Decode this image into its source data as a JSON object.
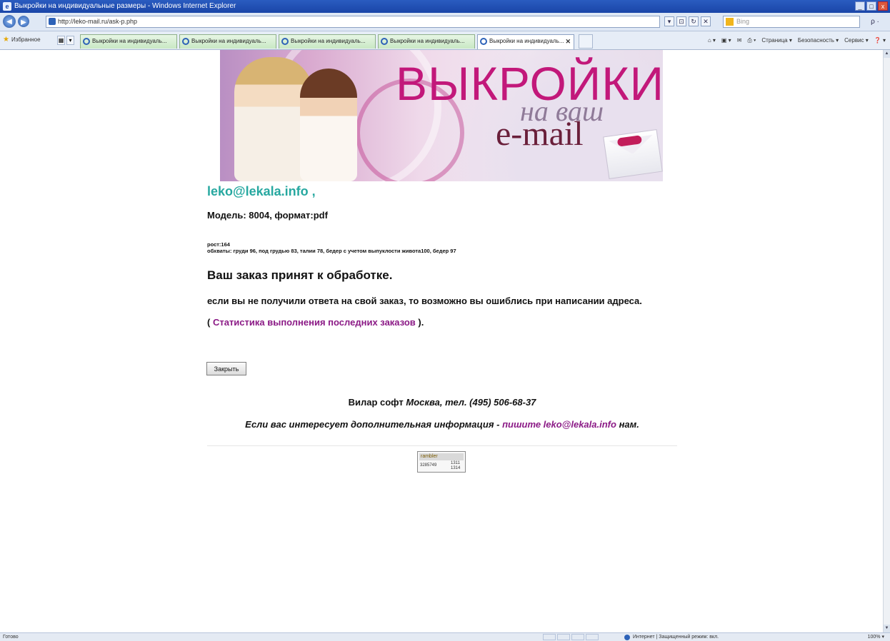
{
  "window": {
    "title": "Выкройки на индивидуальные размеры - Windows Internet Explorer",
    "controls": {
      "minimize": "_",
      "maximize": "□",
      "close": "x"
    }
  },
  "addressbar": {
    "back": "◀",
    "forward": "▶",
    "url": "http://leko-mail.ru/ask-p.php",
    "search_placeholder": "Bing",
    "search_go": "ρ ·",
    "tools": [
      "▾",
      "⊡",
      "↻",
      "✕"
    ]
  },
  "tabsbar": {
    "favorites": "Избранное",
    "tabs": [
      {
        "label": "Выкройки на индивидуаль..."
      },
      {
        "label": "Выкройки на индивидуаль..."
      },
      {
        "label": "Выкройки на индивидуаль..."
      },
      {
        "label": "Выкройки на индивидуаль..."
      },
      {
        "label": "Выкройки на индивидуаль..."
      }
    ],
    "active_tab_close": "✕",
    "commands": [
      "Страница ▾",
      "Безопасность ▾",
      "Сервис ▾",
      "❓ ▾"
    ]
  },
  "banner": {
    "line1": "ВЫКРОЙКИ",
    "line2": "на ваш",
    "line3": "e-mail",
    "colors": {
      "title": "#c2187a",
      "email": "#6a1f3a"
    }
  },
  "content": {
    "email": "leko@lekala.info ,",
    "model": "Модель: 8004, формат:pdf",
    "height": "рост:164",
    "measurements": "обхваты: груди 96, под грудью 83, талии 78, бедер с учетом выпуклости живота100, бедер 97",
    "accepted": "Ваш заказ принят к обработке.",
    "warning": "если вы не получили ответа на свой заказ, то возможно вы ошиблись при написании адреса.",
    "stats_open": "( ",
    "stats_link": "Статистика выполнения последних заказов",
    "stats_close": " ).",
    "close_button": "Закрыть",
    "footer_company": "Вилар софт ",
    "footer_phone": "Москва, тел. (495) 506-68-37",
    "footer_info": "Если вас интересует дополнительная информация  - ",
    "footer_link": "пишите leko@lekala.info",
    "footer_end": " нам.",
    "counter_title": "rambler",
    "counter_n1": "3285749",
    "counter_n2": "1311\n1314"
  },
  "statusbar": {
    "left": "Готово",
    "zone": "Интернет | Защищенный режим: вкл.",
    "zoom": "100% ▾"
  }
}
